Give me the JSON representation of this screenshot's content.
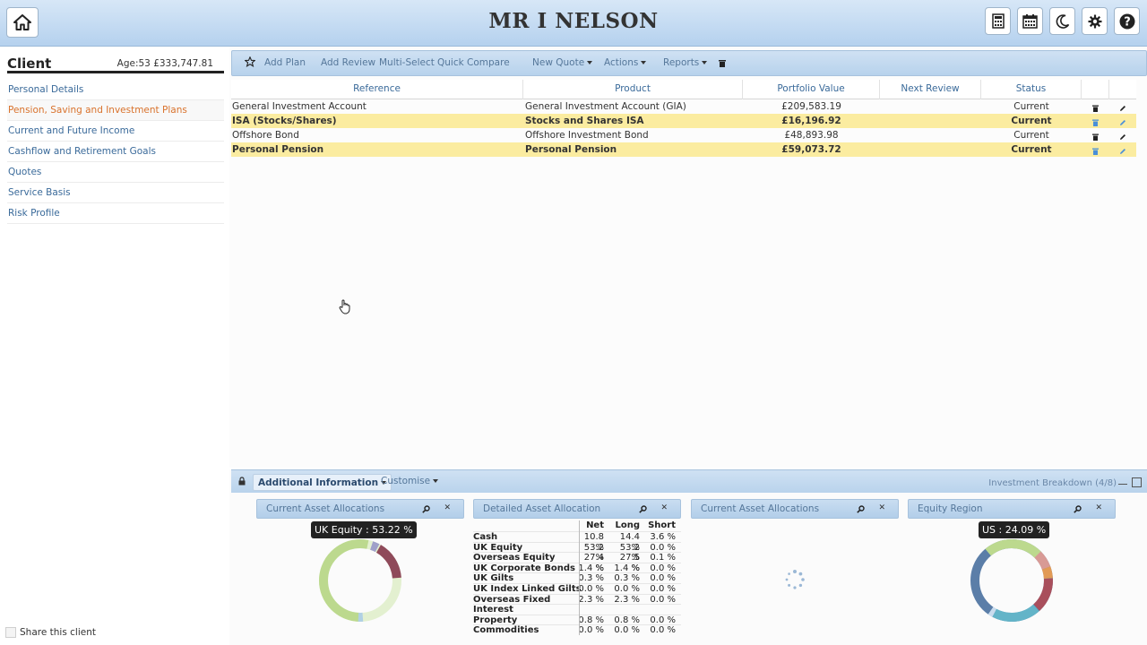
{
  "header": {
    "title": "MR I NELSON",
    "icons": [
      "home-icon",
      "calculator-icon",
      "calendar-icon",
      "moon-icon",
      "gear-icon",
      "help-icon"
    ]
  },
  "sidebar": {
    "title": "Client",
    "info": "Age:53 £333,747.81",
    "items": [
      {
        "label": "Personal Details"
      },
      {
        "label": "Pension, Saving and Investment Plans",
        "active": true
      },
      {
        "label": "Current and Future Income"
      },
      {
        "label": "Cashflow and Retirement Goals"
      },
      {
        "label": "Quotes"
      },
      {
        "label": "Service Basis"
      },
      {
        "label": "Risk Profile"
      }
    ],
    "share_label": "Share this client"
  },
  "toolbar": {
    "add_plan": "Add Plan",
    "add_review": "Add Review",
    "multi_select": "Multi-Select",
    "quick_compare": "Quick Compare",
    "new_quote": "New Quote",
    "actions": "Actions",
    "reports": "Reports"
  },
  "table": {
    "columns": [
      "Reference",
      "Product",
      "Portfolio Value",
      "Next Review",
      "Status"
    ],
    "rows": [
      {
        "reference": "General Investment Account",
        "product": "General Investment Account (GIA)",
        "value": "£209,583.19",
        "next_review": "",
        "status": "Current",
        "highlight": false
      },
      {
        "reference": "ISA (Stocks/Shares)",
        "product": "Stocks and Shares ISA",
        "value": "£16,196.92",
        "next_review": "",
        "status": "Current",
        "highlight": true
      },
      {
        "reference": "Offshore Bond",
        "product": "Offshore Investment Bond",
        "value": "£48,893.98",
        "next_review": "",
        "status": "Current",
        "highlight": false
      },
      {
        "reference": "Personal Pension",
        "product": "Personal Pension",
        "value": "£59,073.72",
        "next_review": "",
        "status": "Current",
        "highlight": true
      }
    ]
  },
  "bottom": {
    "additional_info": "Additional Information",
    "customise": "Customise",
    "breakdown": "Investment Breakdown (4/8)",
    "widgets": [
      {
        "title": "Current Asset Allocations"
      },
      {
        "title": "Detailed Asset Allocation"
      },
      {
        "title": "Current Asset Allocations"
      },
      {
        "title": "Equity Region"
      }
    ],
    "tooltip1": "UK Equity : 53.22 %",
    "tooltip2": "US : 24.09 %",
    "allocation": {
      "headers": [
        "Net",
        "Long",
        "Short"
      ],
      "rows": [
        {
          "label": "Cash",
          "net": "10.8 %",
          "long": "14.4 %",
          "short": "3.6 %"
        },
        {
          "label": "UK Equity",
          "net": "53.2 %",
          "long": "53.2 %",
          "short": "0.0 %"
        },
        {
          "label": "Overseas Equity",
          "net": "27.4 %",
          "long": "27.5 %",
          "short": "0.1 %"
        },
        {
          "label": "UK Corporate Bonds",
          "net": "1.4 %",
          "long": "1.4 %",
          "short": "0.0 %"
        },
        {
          "label": "UK Gilts",
          "net": "0.3 %",
          "long": "0.3 %",
          "short": "0.0 %"
        },
        {
          "label": "UK Index Linked Gilts",
          "net": "0.0 %",
          "long": "0.0 %",
          "short": "0.0 %"
        },
        {
          "label": "Overseas Fixed",
          "net": "2.3 %",
          "long": "2.3 %",
          "short": "0.0 %"
        },
        {
          "label": "Interest",
          "net": "",
          "long": "",
          "short": ""
        },
        {
          "label": "Property",
          "net": "0.8 %",
          "long": "0.8 %",
          "short": "0.0 %"
        },
        {
          "label": "Commodities",
          "net": "0.0 %",
          "long": "0.0 %",
          "short": "0.0 %"
        }
      ]
    }
  }
}
